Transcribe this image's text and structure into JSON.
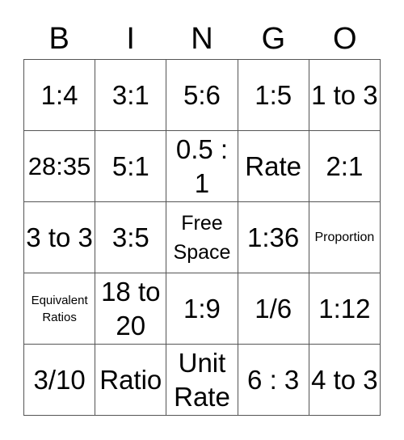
{
  "header": [
    "B",
    "I",
    "N",
    "G",
    "O"
  ],
  "cells": [
    [
      "1:4",
      "3:1",
      "5:6",
      "1:5",
      "1 to 3"
    ],
    [
      "28:35",
      "5:1",
      "0.5 : 1",
      "Rate",
      "2:1"
    ],
    [
      "3 to 3",
      "3:5",
      "Free Space",
      "1:36",
      "Proportion"
    ],
    [
      "Equivalent Ratios",
      "18 to 20",
      "1:9",
      "1/6",
      "1:12"
    ],
    [
      "3/10",
      "Ratio",
      "Unit Rate",
      "6 : 3",
      "4 to 3"
    ]
  ]
}
